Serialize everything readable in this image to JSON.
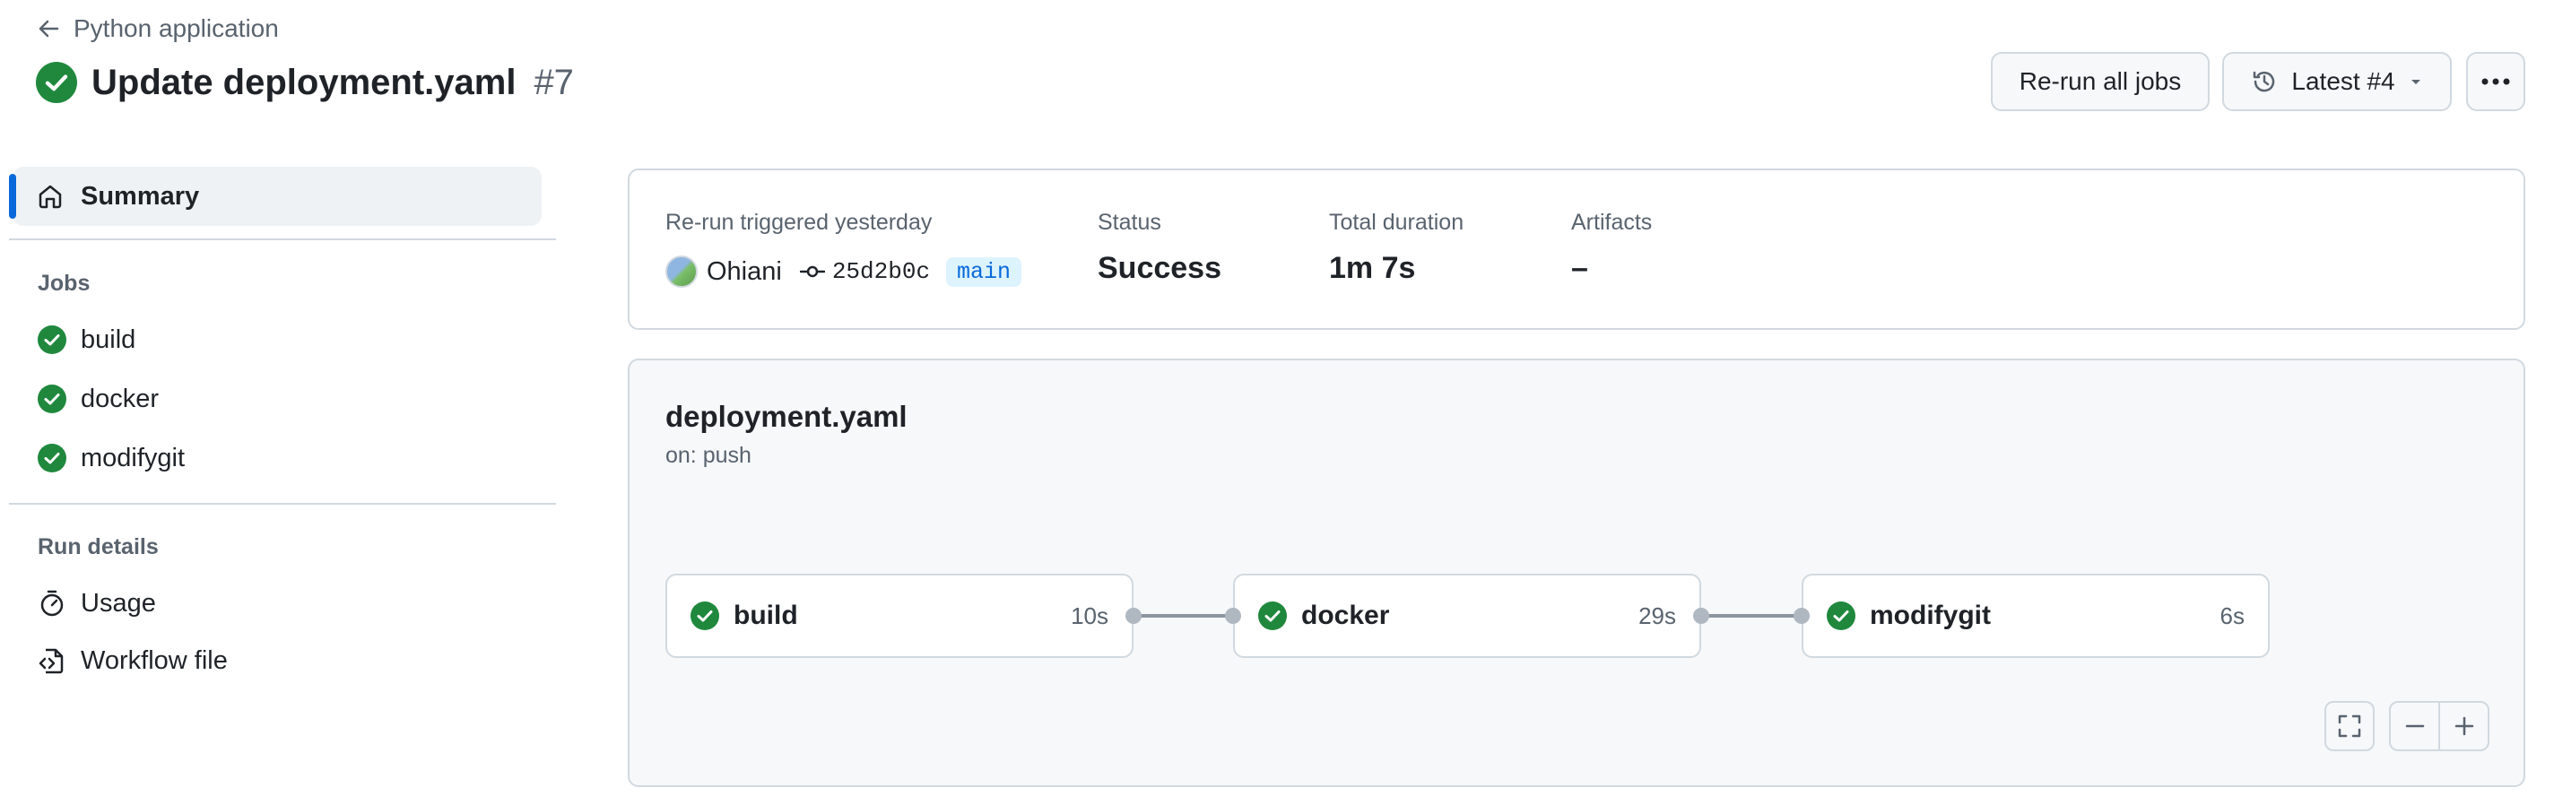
{
  "header": {
    "back_label": "Python application",
    "title": "Update deployment.yaml",
    "run_number": "#7",
    "rerun_label": "Re-run all jobs",
    "latest_label": "Latest #4"
  },
  "sidebar": {
    "summary_label": "Summary",
    "jobs_heading": "Jobs",
    "jobs": [
      {
        "label": "build"
      },
      {
        "label": "docker"
      },
      {
        "label": "modifygit"
      }
    ],
    "run_details_heading": "Run details",
    "details": [
      {
        "label": "Usage",
        "icon": "stopwatch-icon"
      },
      {
        "label": "Workflow file",
        "icon": "file-code-icon"
      }
    ]
  },
  "summary": {
    "trigger_label": "Re-run triggered yesterday",
    "actor": "Ohiani",
    "commit": "25d2b0c",
    "branch": "main",
    "status_label": "Status",
    "status_value": "Success",
    "duration_label": "Total duration",
    "duration_value": "1m 7s",
    "artifacts_label": "Artifacts",
    "artifacts_value": "–"
  },
  "workflow": {
    "file": "deployment.yaml",
    "trigger": "on: push",
    "jobs": [
      {
        "name": "build",
        "duration": "10s"
      },
      {
        "name": "docker",
        "duration": "29s"
      },
      {
        "name": "modifygit",
        "duration": "6s"
      }
    ]
  },
  "colors": {
    "success": "#1f883d",
    "accent": "#0969da",
    "border": "#d1d9e0",
    "muted_text": "#59636e"
  }
}
